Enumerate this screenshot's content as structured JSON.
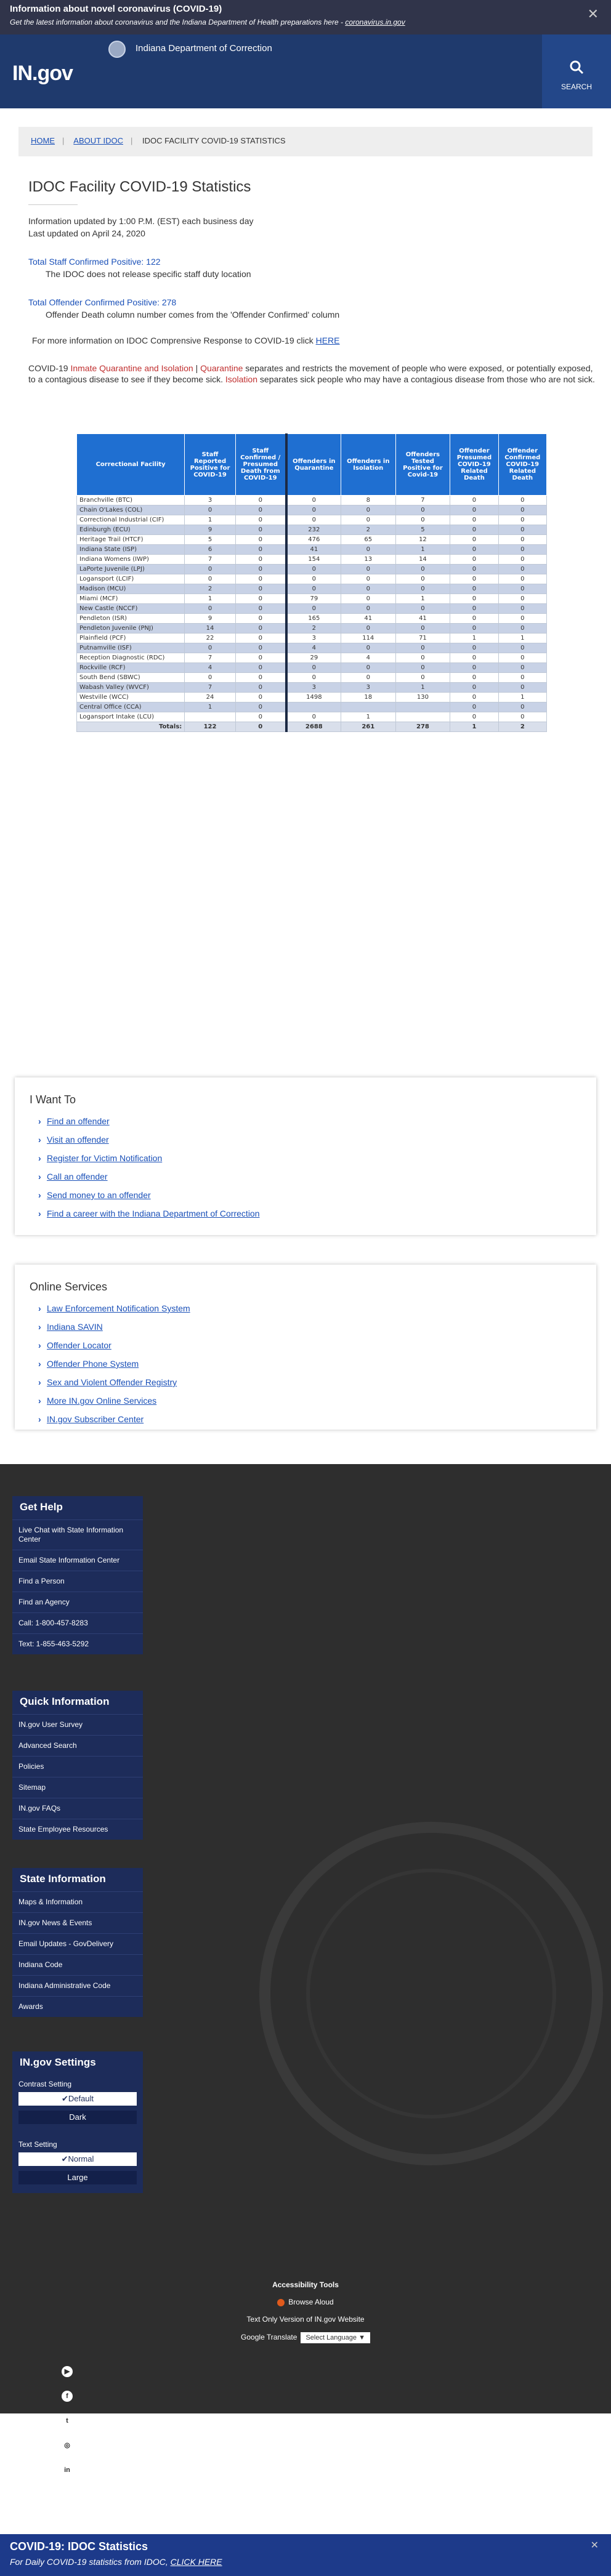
{
  "alert": {
    "title": "Information about novel coronavirus (COVID-19)",
    "subtitle": "Get the latest information about coronavirus and the Indiana Department of Health preparations here - ",
    "link": "coronavirus.in.gov",
    "close": "✕"
  },
  "header": {
    "logo": "IN.gov",
    "agency": "Indiana Department of Correction",
    "search_label": "SEARCH",
    "search_icon": "magnifier-icon"
  },
  "breadcrumb": [
    "HOME",
    "ABOUT IDOC",
    "IDOC FACILITY COVID-19 STATISTICS"
  ],
  "main": {
    "title": "IDOC Facility COVID-19 Statistics",
    "updated1": "Information updated by 1:00 P.M. (EST) each business day",
    "updated2": "Last updated on April 24, 2020",
    "staff_positive": "Total Staff Confirmed Positive: 122",
    "staff_note": "The IDOC does not release specific staff duty location",
    "offender_positive": "Total Offender Confirmed Positive: 278",
    "offender_note": "Offender Death column number comes from the 'Offender Confirmed' column",
    "more_info": "For more information on IDOC Comprensive Response to COVID-19 click ",
    "more_link": "HERE",
    "para_a": "COVID-19 ",
    "para_b": "Inmate Quarantine and Isolation",
    "para_c": " | ",
    "para_d": "Quarantine",
    "para_e": " separates and restricts the movement of people who were exposed, or potentially exposed, to a contagious disease to see if they become sick. ",
    "para_f": "Isolation",
    "para_g": " separates sick people who may have a contagious disease from those who are not sick."
  },
  "table": {
    "headers": [
      "Correctional Facility",
      "Staff Reported Positive for COVID-19",
      "Staff Confirmed / Presumed Death from COVID-19",
      "Offenders in Quarantine",
      "Offenders in Isolation",
      "Offenders Tested Positive for Covid-19",
      "Offender Presumed COVID-19 Related Death",
      "Offender Confirmed COVID-19 Related Death"
    ],
    "rows": [
      [
        "Branchville (BTC)",
        "3",
        "0",
        "0",
        "8",
        "7",
        "0",
        "0"
      ],
      [
        "Chain O'Lakes (COL)",
        "0",
        "0",
        "0",
        "0",
        "0",
        "0",
        "0"
      ],
      [
        "Correctional Industrial (CIF)",
        "1",
        "0",
        "0",
        "0",
        "0",
        "0",
        "0"
      ],
      [
        "Edinburgh (ECU)",
        "9",
        "0",
        "232",
        "2",
        "5",
        "0",
        "0"
      ],
      [
        "Heritage Trail (HTCF)",
        "5",
        "0",
        "476",
        "65",
        "12",
        "0",
        "0"
      ],
      [
        "Indiana State (ISP)",
        "6",
        "0",
        "41",
        "0",
        "1",
        "0",
        "0"
      ],
      [
        "Indiana Womens (IWP)",
        "7",
        "0",
        "154",
        "13",
        "14",
        "0",
        "0"
      ],
      [
        "LaPorte Juvenile (LPJ)",
        "0",
        "0",
        "0",
        "0",
        "0",
        "0",
        "0"
      ],
      [
        "Logansport (LCIF)",
        "0",
        "0",
        "0",
        "0",
        "0",
        "0",
        "0"
      ],
      [
        "Madison (MCU)",
        "2",
        "0",
        "0",
        "0",
        "0",
        "0",
        "0"
      ],
      [
        "Miami (MCF)",
        "1",
        "0",
        "79",
        "0",
        "1",
        "0",
        "0"
      ],
      [
        "New Castle (NCCF)",
        "0",
        "0",
        "0",
        "0",
        "0",
        "0",
        "0"
      ],
      [
        "Pendleton (ISR)",
        "9",
        "0",
        "165",
        "41",
        "41",
        "0",
        "0"
      ],
      [
        "Pendleton Juvenile (PNJ)",
        "14",
        "0",
        "2",
        "0",
        "0",
        "0",
        "0"
      ],
      [
        "Plainfield (PCF)",
        "22",
        "0",
        "3",
        "114",
        "71",
        "1",
        "1"
      ],
      [
        "Putnamville (ISF)",
        "0",
        "0",
        "4",
        "0",
        "0",
        "0",
        "0"
      ],
      [
        "Reception Diagnostic (RDC)",
        "7",
        "0",
        "29",
        "4",
        "0",
        "0",
        "0"
      ],
      [
        "Rockville (RCF)",
        "4",
        "0",
        "0",
        "0",
        "0",
        "0",
        "0"
      ],
      [
        "South Bend (SBWC)",
        "0",
        "0",
        "0",
        "0",
        "0",
        "0",
        "0"
      ],
      [
        "Wabash Valley (WVCF)",
        "7",
        "0",
        "3",
        "3",
        "1",
        "0",
        "0"
      ],
      [
        "Westville (WCC)",
        "24",
        "0",
        "1498",
        "18",
        "130",
        "0",
        "1"
      ],
      [
        "Central Office (CCA)",
        "1",
        "0",
        "",
        "",
        "",
        "0",
        "0"
      ],
      [
        "Logansport Intake (LCU)",
        "",
        "0",
        "0",
        "1",
        "",
        "0",
        "0"
      ]
    ],
    "totals": [
      "Totals:",
      "122",
      "0",
      "2688",
      "261",
      "278",
      "1",
      "2"
    ]
  },
  "i_want_to": {
    "title": "I Want To",
    "items": [
      "Find an offender",
      "Visit an offender",
      "Register for Victim Notification",
      "Call an offender",
      "Send money to an offender",
      "Find a career with the Indiana Department of Correction"
    ]
  },
  "online_services": {
    "title": "Online Services",
    "items": [
      "Law Enforcement Notification System",
      "Indiana SAVIN",
      "Offender Locator",
      "Offender Phone System",
      "Sex and Violent Offender Registry",
      "More IN.gov Online Services",
      "IN.gov Subscriber Center"
    ]
  },
  "footer": {
    "get_help": {
      "title": "Get Help",
      "items": [
        "Live Chat with State Information Center",
        "Email State Information Center",
        "Find a Person",
        "Find an Agency",
        "Call: 1-800-457-8283",
        "Text: 1-855-463-5292"
      ]
    },
    "quick_info": {
      "title": "Quick Information",
      "items": [
        "IN.gov User Survey",
        "Advanced Search",
        "Policies",
        "Sitemap",
        "IN.gov FAQs",
        "State Employee Resources"
      ]
    },
    "state_info": {
      "title": "State Information",
      "items": [
        "Maps & Information",
        "IN.gov News & Events",
        "Email Updates - GovDelivery",
        "Indiana Code",
        "Indiana Administrative Code",
        "Awards"
      ]
    },
    "settings": {
      "title": "IN.gov Settings",
      "contrast_label": "Contrast Setting",
      "contrast_default": "✔Default",
      "contrast_dark": "Dark",
      "text_label": "Text Setting",
      "text_normal": "✔Normal",
      "text_large": "Large"
    },
    "accessibility": {
      "title": "Accessibility Tools",
      "browse_aloud": "Browse Aloud",
      "text_only": "Text Only Version of IN.gov Website",
      "google_translate": "Google Translate",
      "language": "Select Language ▼"
    },
    "social": [
      "youtube-icon",
      "facebook-icon",
      "twitter-icon",
      "instagram-icon",
      "linkedin-icon"
    ]
  },
  "banner": {
    "title": "COVID-19: IDOC Statistics",
    "subtitle": "For Daily COVID-19 statistics from IDOC, ",
    "link": "CLICK HERE",
    "close": "✕"
  }
}
